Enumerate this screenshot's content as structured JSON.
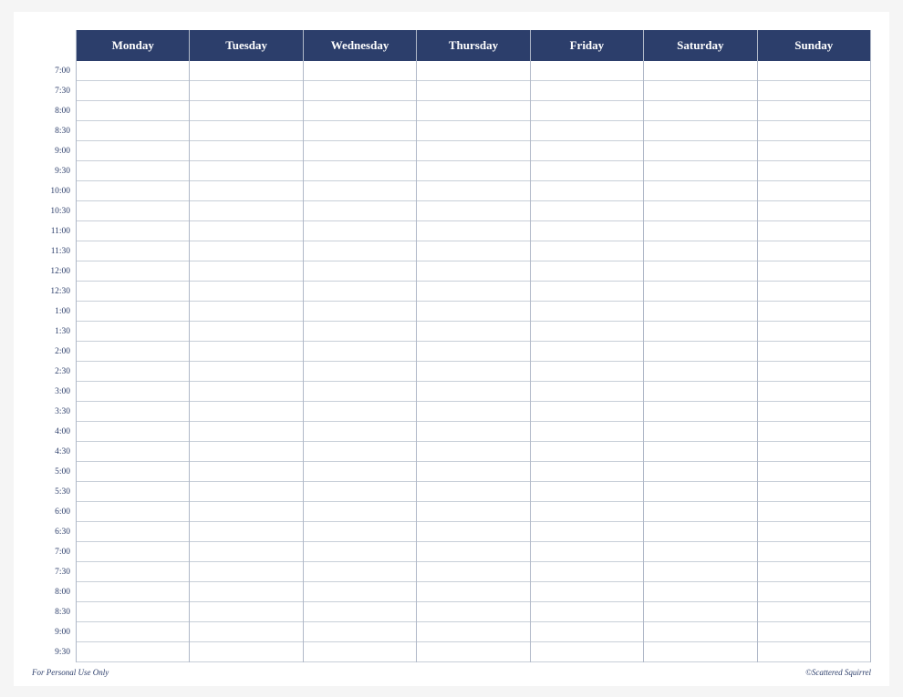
{
  "header": {
    "days": [
      "Monday",
      "Tuesday",
      "Wednesday",
      "Thursday",
      "Friday",
      "Saturday",
      "Sunday"
    ]
  },
  "times": [
    "7:00",
    "7:30",
    "8:00",
    "8:30",
    "9:00",
    "9:30",
    "10:00",
    "10:30",
    "11:00",
    "11:30",
    "12:00",
    "12:30",
    "1:00",
    "1:30",
    "2:00",
    "2:30",
    "3:00",
    "3:30",
    "4:00",
    "4:30",
    "5:00",
    "5:30",
    "6:00",
    "6:30",
    "7:00",
    "7:30",
    "8:00",
    "8:30",
    "9:00",
    "9:30"
  ],
  "footer": {
    "left": "For Personal Use Only",
    "right": "©Scattered Squirrel"
  }
}
